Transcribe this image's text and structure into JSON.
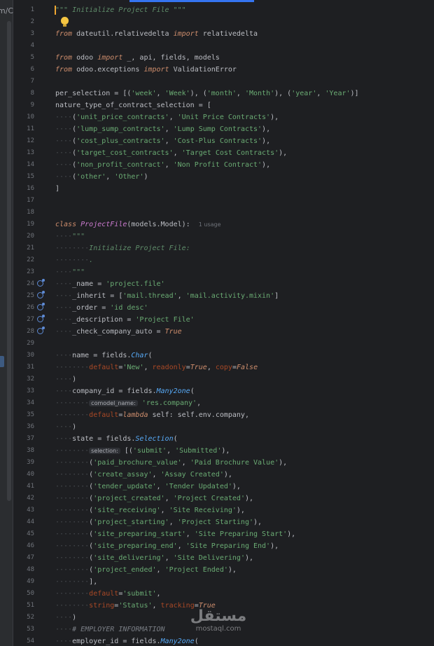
{
  "editor": {
    "breadcrumb_fragment": "m/C",
    "watermark_ar": "مستقل",
    "watermark_en": "mostaql.com"
  },
  "lines": [
    {
      "n": "1",
      "cursor": true,
      "tokens": [
        {
          "t": "\"\"\" Initialize Project File \"\"\"",
          "c": "doc"
        }
      ]
    },
    {
      "n": "2",
      "bulb": true,
      "tokens": []
    },
    {
      "n": "3",
      "tokens": [
        {
          "t": "from",
          "c": "kw"
        },
        {
          "t": " dateutil.relativedelta "
        },
        {
          "t": "import",
          "c": "kw"
        },
        {
          "t": " relativedelta"
        }
      ]
    },
    {
      "n": "4",
      "tokens": []
    },
    {
      "n": "5",
      "tokens": [
        {
          "t": "from",
          "c": "kw"
        },
        {
          "t": " odoo "
        },
        {
          "t": "import",
          "c": "kw"
        },
        {
          "t": " _, api, fields, models"
        }
      ]
    },
    {
      "n": "6",
      "tokens": [
        {
          "t": "from",
          "c": "kw"
        },
        {
          "t": " odoo.exceptions "
        },
        {
          "t": "import",
          "c": "kw"
        },
        {
          "t": " ValidationError"
        }
      ]
    },
    {
      "n": "7",
      "tokens": []
    },
    {
      "n": "8",
      "tokens": [
        {
          "t": "per_selection = [("
        },
        {
          "t": "'week'",
          "c": "str"
        },
        {
          "t": ", "
        },
        {
          "t": "'Week'",
          "c": "str"
        },
        {
          "t": "), ("
        },
        {
          "t": "'month'",
          "c": "str"
        },
        {
          "t": ", "
        },
        {
          "t": "'Month'",
          "c": "str"
        },
        {
          "t": "), ("
        },
        {
          "t": "'year'",
          "c": "str"
        },
        {
          "t": ", "
        },
        {
          "t": "'Year'",
          "c": "str"
        },
        {
          "t": ")]"
        }
      ]
    },
    {
      "n": "9",
      "tokens": [
        {
          "t": "nature_type_of_contract_selection = ["
        }
      ]
    },
    {
      "n": "10",
      "tokens": [
        {
          "t": "····",
          "c": "ws"
        },
        {
          "t": "("
        },
        {
          "t": "'unit_price_contracts'",
          "c": "str"
        },
        {
          "t": ", "
        },
        {
          "t": "'Unit Price Contracts'",
          "c": "str"
        },
        {
          "t": "),"
        }
      ]
    },
    {
      "n": "11",
      "tokens": [
        {
          "t": "····",
          "c": "ws"
        },
        {
          "t": "("
        },
        {
          "t": "'lump_sump_contracts'",
          "c": "str"
        },
        {
          "t": ", "
        },
        {
          "t": "'Lump Sump Contracts'",
          "c": "str"
        },
        {
          "t": "),"
        }
      ]
    },
    {
      "n": "12",
      "tokens": [
        {
          "t": "····",
          "c": "ws"
        },
        {
          "t": "("
        },
        {
          "t": "'cost_plus_contracts'",
          "c": "str"
        },
        {
          "t": ", "
        },
        {
          "t": "'Cost-Plus Contracts'",
          "c": "str"
        },
        {
          "t": "),"
        }
      ]
    },
    {
      "n": "13",
      "tokens": [
        {
          "t": "····",
          "c": "ws"
        },
        {
          "t": "("
        },
        {
          "t": "'target_cost_contracts'",
          "c": "str"
        },
        {
          "t": ", "
        },
        {
          "t": "'Target Cost Contracts'",
          "c": "str"
        },
        {
          "t": "),"
        }
      ]
    },
    {
      "n": "14",
      "tokens": [
        {
          "t": "····",
          "c": "ws"
        },
        {
          "t": "("
        },
        {
          "t": "'non_profit_contract'",
          "c": "str"
        },
        {
          "t": ", "
        },
        {
          "t": "'Non Profit Contract'",
          "c": "str"
        },
        {
          "t": "),"
        }
      ]
    },
    {
      "n": "15",
      "tokens": [
        {
          "t": "····",
          "c": "ws"
        },
        {
          "t": "("
        },
        {
          "t": "'other'",
          "c": "str"
        },
        {
          "t": ", "
        },
        {
          "t": "'Other'",
          "c": "str"
        },
        {
          "t": ")"
        }
      ]
    },
    {
      "n": "16",
      "tokens": [
        {
          "t": "]"
        }
      ]
    },
    {
      "n": "17",
      "tokens": []
    },
    {
      "n": "18",
      "tokens": []
    },
    {
      "n": "19",
      "tokens": [
        {
          "t": "class",
          "c": "kw"
        },
        {
          "t": " "
        },
        {
          "t": "ProjectFile",
          "c": "cls"
        },
        {
          "t": "(models.Model):  "
        },
        {
          "t": "1 usage",
          "c": "hint"
        }
      ]
    },
    {
      "n": "20",
      "tokens": [
        {
          "t": "····",
          "c": "ws"
        },
        {
          "t": "\"\"\"",
          "c": "doc"
        }
      ]
    },
    {
      "n": "21",
      "tokens": [
        {
          "t": "········",
          "c": "ws"
        },
        {
          "t": "Initialize Project File:",
          "c": "doc"
        }
      ]
    },
    {
      "n": "22",
      "tokens": [
        {
          "t": "········",
          "c": "ws"
        },
        {
          "t": ".",
          "c": "doc"
        }
      ]
    },
    {
      "n": "23",
      "tokens": [
        {
          "t": "····",
          "c": "ws"
        },
        {
          "t": "\"\"\"",
          "c": "doc"
        }
      ]
    },
    {
      "n": "24",
      "gicon": true,
      "tokens": [
        {
          "t": "····",
          "c": "ws"
        },
        {
          "t": "_name = "
        },
        {
          "t": "'project.file'",
          "c": "str"
        }
      ]
    },
    {
      "n": "25",
      "gicon": true,
      "tokens": [
        {
          "t": "····",
          "c": "ws"
        },
        {
          "t": "_inherit = ["
        },
        {
          "t": "'mail.thread'",
          "c": "str"
        },
        {
          "t": ", "
        },
        {
          "t": "'mail.activity.mixin'",
          "c": "str"
        },
        {
          "t": "]"
        }
      ]
    },
    {
      "n": "26",
      "gicon": true,
      "tokens": [
        {
          "t": "····",
          "c": "ws"
        },
        {
          "t": "_order = "
        },
        {
          "t": "'id desc'",
          "c": "str"
        }
      ]
    },
    {
      "n": "27",
      "gicon": true,
      "tokens": [
        {
          "t": "····",
          "c": "ws"
        },
        {
          "t": "_description = "
        },
        {
          "t": "'Project File'",
          "c": "str"
        }
      ]
    },
    {
      "n": "28",
      "gicon": true,
      "tokens": [
        {
          "t": "····",
          "c": "ws"
        },
        {
          "t": "_check_company_auto = "
        },
        {
          "t": "True",
          "c": "const"
        }
      ]
    },
    {
      "n": "29",
      "tokens": []
    },
    {
      "n": "30",
      "tokens": [
        {
          "t": "····",
          "c": "ws"
        },
        {
          "t": "name = fields."
        },
        {
          "t": "Char",
          "c": "fn"
        },
        {
          "t": "("
        }
      ]
    },
    {
      "n": "31",
      "tokens": [
        {
          "t": "········",
          "c": "ws"
        },
        {
          "t": "default",
          "c": "kwarg"
        },
        {
          "t": "="
        },
        {
          "t": "'New'",
          "c": "str"
        },
        {
          "t": ", "
        },
        {
          "t": "readonly",
          "c": "kwarg"
        },
        {
          "t": "="
        },
        {
          "t": "True",
          "c": "const"
        },
        {
          "t": ", "
        },
        {
          "t": "copy",
          "c": "kwarg"
        },
        {
          "t": "="
        },
        {
          "t": "False",
          "c": "const"
        }
      ]
    },
    {
      "n": "32",
      "tokens": [
        {
          "t": "····",
          "c": "ws"
        },
        {
          "t": ")"
        }
      ]
    },
    {
      "n": "33",
      "tokens": [
        {
          "t": "····",
          "c": "ws"
        },
        {
          "t": "company_id = fields."
        },
        {
          "t": "Many2one",
          "c": "fn"
        },
        {
          "t": "("
        }
      ]
    },
    {
      "n": "34",
      "tokens": [
        {
          "t": "········",
          "c": "ws"
        },
        {
          "t": "comodel_name:",
          "c": "inlay"
        },
        {
          "t": " "
        },
        {
          "t": "'res.company'",
          "c": "str"
        },
        {
          "t": ","
        }
      ]
    },
    {
      "n": "35",
      "tokens": [
        {
          "t": "········",
          "c": "ws"
        },
        {
          "t": "default",
          "c": "kwarg"
        },
        {
          "t": "="
        },
        {
          "t": "lambda",
          "c": "kw"
        },
        {
          "t": " self: self.env.company,"
        }
      ]
    },
    {
      "n": "36",
      "tokens": [
        {
          "t": "····",
          "c": "ws"
        },
        {
          "t": ")"
        }
      ]
    },
    {
      "n": "37",
      "tokens": [
        {
          "t": "····",
          "c": "ws"
        },
        {
          "t": "state = fields."
        },
        {
          "t": "Selection",
          "c": "fn"
        },
        {
          "t": "("
        }
      ]
    },
    {
      "n": "38",
      "tokens": [
        {
          "t": "········",
          "c": "ws"
        },
        {
          "t": "selection:",
          "c": "inlay"
        },
        {
          "t": " [("
        },
        {
          "t": "'submit'",
          "c": "str"
        },
        {
          "t": ", "
        },
        {
          "t": "'Submitted'",
          "c": "str"
        },
        {
          "t": "),"
        }
      ]
    },
    {
      "n": "39",
      "tokens": [
        {
          "t": "········",
          "c": "ws"
        },
        {
          "t": "("
        },
        {
          "t": "'paid_brochure_value'",
          "c": "str"
        },
        {
          "t": ", "
        },
        {
          "t": "'Paid Brochure Value'",
          "c": "str"
        },
        {
          "t": "),"
        }
      ]
    },
    {
      "n": "40",
      "tokens": [
        {
          "t": "········",
          "c": "ws"
        },
        {
          "t": "("
        },
        {
          "t": "'create_assay'",
          "c": "str"
        },
        {
          "t": ", "
        },
        {
          "t": "'Assay Created'",
          "c": "str"
        },
        {
          "t": "),"
        }
      ]
    },
    {
      "n": "41",
      "tokens": [
        {
          "t": "········",
          "c": "ws"
        },
        {
          "t": "("
        },
        {
          "t": "'tender_update'",
          "c": "str"
        },
        {
          "t": ", "
        },
        {
          "t": "'Tender Updated'",
          "c": "str"
        },
        {
          "t": "),"
        }
      ]
    },
    {
      "n": "42",
      "tokens": [
        {
          "t": "········",
          "c": "ws"
        },
        {
          "t": "("
        },
        {
          "t": "'project_created'",
          "c": "str"
        },
        {
          "t": ", "
        },
        {
          "t": "'Project Created'",
          "c": "str"
        },
        {
          "t": "),"
        }
      ]
    },
    {
      "n": "43",
      "tokens": [
        {
          "t": "········",
          "c": "ws"
        },
        {
          "t": "("
        },
        {
          "t": "'site_receiving'",
          "c": "str"
        },
        {
          "t": ", "
        },
        {
          "t": "'Site Receiving'",
          "c": "str"
        },
        {
          "t": "),"
        }
      ]
    },
    {
      "n": "44",
      "tokens": [
        {
          "t": "········",
          "c": "ws"
        },
        {
          "t": "("
        },
        {
          "t": "'project_starting'",
          "c": "str"
        },
        {
          "t": ", "
        },
        {
          "t": "'Project Starting'",
          "c": "str"
        },
        {
          "t": "),"
        }
      ]
    },
    {
      "n": "45",
      "tokens": [
        {
          "t": "········",
          "c": "ws"
        },
        {
          "t": "("
        },
        {
          "t": "'site_preparing_start'",
          "c": "str"
        },
        {
          "t": ", "
        },
        {
          "t": "'Site Preparing Start'",
          "c": "str"
        },
        {
          "t": "),"
        }
      ]
    },
    {
      "n": "46",
      "tokens": [
        {
          "t": "········",
          "c": "ws"
        },
        {
          "t": "("
        },
        {
          "t": "'site_preparing_end'",
          "c": "str"
        },
        {
          "t": ", "
        },
        {
          "t": "'Site Preparing End'",
          "c": "str"
        },
        {
          "t": "),"
        }
      ]
    },
    {
      "n": "47",
      "tokens": [
        {
          "t": "········",
          "c": "ws"
        },
        {
          "t": "("
        },
        {
          "t": "'site_delivering'",
          "c": "str"
        },
        {
          "t": ", "
        },
        {
          "t": "'Site Delivering'",
          "c": "str"
        },
        {
          "t": "),"
        }
      ]
    },
    {
      "n": "48",
      "tokens": [
        {
          "t": "········",
          "c": "ws"
        },
        {
          "t": "("
        },
        {
          "t": "'project_ended'",
          "c": "str"
        },
        {
          "t": ", "
        },
        {
          "t": "'Project Ended'",
          "c": "str"
        },
        {
          "t": "),"
        }
      ]
    },
    {
      "n": "49",
      "tokens": [
        {
          "t": "········",
          "c": "ws"
        },
        {
          "t": "],"
        }
      ]
    },
    {
      "n": "50",
      "tokens": [
        {
          "t": "········",
          "c": "ws"
        },
        {
          "t": "default",
          "c": "kwarg"
        },
        {
          "t": "="
        },
        {
          "t": "'submit'",
          "c": "str"
        },
        {
          "t": ","
        }
      ]
    },
    {
      "n": "51",
      "tokens": [
        {
          "t": "········",
          "c": "ws"
        },
        {
          "t": "string",
          "c": "kwarg"
        },
        {
          "t": "="
        },
        {
          "t": "'Status'",
          "c": "str"
        },
        {
          "t": ", "
        },
        {
          "t": "tracking",
          "c": "kwarg"
        },
        {
          "t": "="
        },
        {
          "t": "True",
          "c": "const"
        }
      ]
    },
    {
      "n": "52",
      "tokens": [
        {
          "t": "····",
          "c": "ws"
        },
        {
          "t": ")"
        }
      ]
    },
    {
      "n": "53",
      "tokens": [
        {
          "t": "····",
          "c": "ws"
        },
        {
          "t": "# EMPLOYER INFORMATION",
          "c": "cmt"
        }
      ]
    },
    {
      "n": "54",
      "tokens": [
        {
          "t": "····",
          "c": "ws"
        },
        {
          "t": "employer_id = fields."
        },
        {
          "t": "Many2one",
          "c": "fn"
        },
        {
          "t": "("
        }
      ]
    }
  ]
}
